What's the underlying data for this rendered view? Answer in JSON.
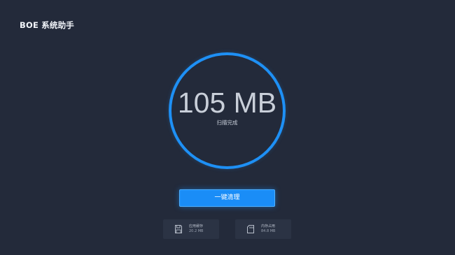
{
  "app": {
    "title": "BOE 系统助手"
  },
  "scan": {
    "size_value": "105 MB",
    "status": "扫描完成",
    "ring_color": "#1e90f5"
  },
  "actions": {
    "clean_label": "一键清理",
    "button_color": "#1a8df7"
  },
  "cards": [
    {
      "label": "应用缓存",
      "value": "20.2 MB",
      "icon": "save-disk-icon"
    },
    {
      "label": "内存占用",
      "value": "84.8 MB",
      "icon": "memory-card-icon"
    }
  ],
  "colors": {
    "background": "#232a3a",
    "card_background": "#2b3344"
  }
}
